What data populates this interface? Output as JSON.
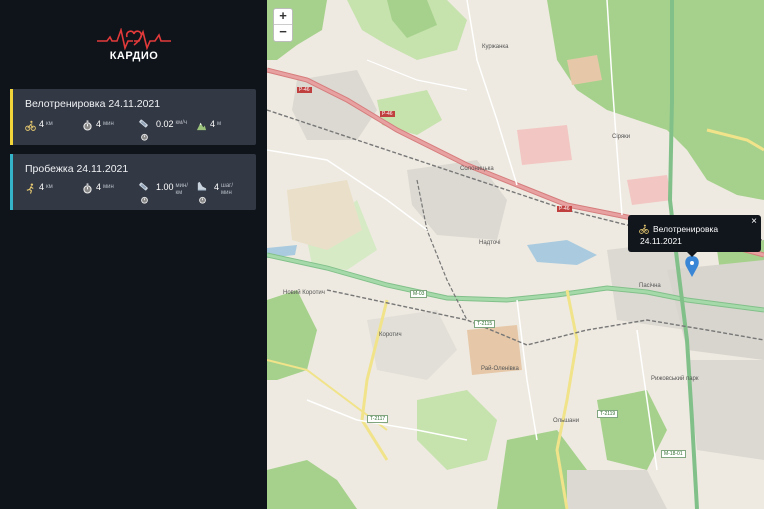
{
  "app": {
    "logo_text": "КАРДИО"
  },
  "colors": {
    "accent_yellow": "#f0d43a",
    "accent_cyan": "#35b3c9",
    "card_bg": "#323844",
    "sidebar_bg": "#0f141b",
    "pin": "#3a86d6"
  },
  "workouts": [
    {
      "title": "Велотренировка 24.11.2021",
      "stats": {
        "distance": {
          "icon": "cyclist-icon",
          "value": "4",
          "unit": "км"
        },
        "time": {
          "icon": "stopwatch-icon",
          "value": "4",
          "unit": "мин"
        },
        "speed": {
          "icon": "speedometer-icon",
          "value": "0.02",
          "unit": "км/ч"
        },
        "elevation": {
          "icon": "mountain-icon",
          "value": "4",
          "unit": "м"
        }
      }
    },
    {
      "title": "Пробежка 24.11.2021",
      "stats": {
        "distance": {
          "icon": "runner-icon",
          "value": "4",
          "unit": "км"
        },
        "time": {
          "icon": "stopwatch-icon",
          "value": "4",
          "unit": "мин"
        },
        "pace": {
          "icon": "speedometer-icon",
          "value": "1.00",
          "unit": "мин/км"
        },
        "cadence": {
          "icon": "shoe-icon",
          "value": "4",
          "unit": "шаг/мин"
        }
      }
    }
  ],
  "map": {
    "zoom_in": "+",
    "zoom_out": "−",
    "popup": {
      "title": "Велотренировка",
      "date": "24.11.2021",
      "close": "×"
    },
    "labels": {
      "kurzhanka": "Куржанка",
      "solonichnyky": "Солоницька",
      "sorjany": "Сіряки",
      "nadtochi": "Надточі",
      "pasichna": "Пасічна",
      "novyi_korotych": "Новий Коротич",
      "korotych": "Коротич",
      "rai_olenivka": "Рай-Оленівка",
      "olshany": "Ольшани",
      "ryzhovka": "Рижовський парк",
      "p46": "P-46",
      "p46b": "P-46",
      "p46c": "P-46",
      "m03": "M-03",
      "m18": "M-18-01",
      "t2115": "T-2115",
      "t2117": "T-2117",
      "t2119": "T-2119"
    }
  }
}
